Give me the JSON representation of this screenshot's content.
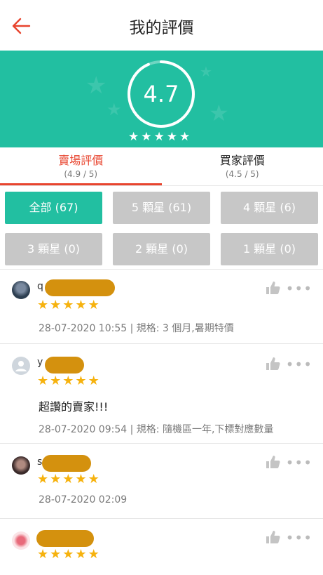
{
  "header": {
    "title": "我的評價",
    "back_icon": "arrow-left-icon",
    "accent": "#e8442e"
  },
  "banner": {
    "score": "4.7",
    "stars": 4.5,
    "color": "#22bfa1"
  },
  "tabs": [
    {
      "label": "賣場評價",
      "sub": "(4.9 / 5)",
      "active": true
    },
    {
      "label": "買家評價",
      "sub": "(4.5 / 5)",
      "active": false
    }
  ],
  "filters": [
    {
      "label": "全部 (67)",
      "active": true
    },
    {
      "label": "5 顆星 (61)"
    },
    {
      "label": "4 顆星 (6)"
    },
    {
      "label": "3 顆星 (0)"
    },
    {
      "label": "2 顆星 (0)"
    },
    {
      "label": "1 顆星 (0)"
    }
  ],
  "reviews": [
    {
      "username": "q",
      "stars": 5,
      "text": "",
      "meta": "28-07-2020 10:55 | 規格: 3 個月,暑期特價"
    },
    {
      "username": "y",
      "stars": 5,
      "text": "超讚的賣家!!!",
      "meta": "28-07-2020 09:54 | 規格: 隨機區一年,下標對應數量"
    },
    {
      "username": "s",
      "stars": 5,
      "text": "",
      "meta": "28-07-2020 02:09"
    },
    {
      "username": "",
      "stars": 5,
      "text": "",
      "meta": ""
    }
  ]
}
